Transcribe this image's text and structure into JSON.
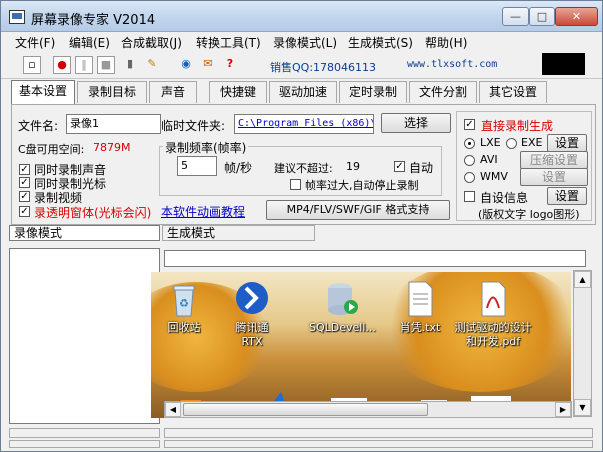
{
  "window": {
    "title": "屏幕录像专家 V2014",
    "min": "—",
    "max": "□",
    "close": "✕"
  },
  "menu": [
    "文件(F)",
    "编辑(E)",
    "合成截取(J)",
    "转换工具(T)",
    "录像模式(L)",
    "生成模式(S)",
    "帮助(H)"
  ],
  "toolbar": {
    "sales": "销售QQ:178046113",
    "site": "www.tlxsoft.com",
    "icons": [
      "new-file-icon",
      "record-icon",
      "pause-icon",
      "stop-icon",
      "camera-icon",
      "brush-icon",
      "globe-icon",
      "gift-icon",
      "help-icon"
    ]
  },
  "tabs": [
    "基本设置",
    "录制目标",
    "声音",
    "快捷键",
    "驱动加速",
    "定时录制",
    "文件分割",
    "其它设置"
  ],
  "basic": {
    "filename_label": "文件名:",
    "filename_value": "录像1",
    "temp_label": "临时文件夹:",
    "temp_value": "C:\\Program Files (x86)\\",
    "choose_btn": "选择",
    "disk_label": "C盘可用空间:",
    "disk_value": "7879M",
    "checks": [
      "同时录制声音",
      "同时录制光标",
      "录制视频",
      "录透明窗体(光标会闪)"
    ],
    "fps_group": "录制频率(帧率)",
    "fps_value": "5",
    "fps_unit": "帧/秒",
    "max_label": "建议不超过:",
    "max_value": "19",
    "auto_label": "自动",
    "stop_label": "帧率过大,自动停止录制",
    "tutorial_link": "本软件动画教程",
    "format_btn": "MP4/FLV/SWF/GIF 格式支持"
  },
  "right": {
    "direct_label": "直接录制生成",
    "lxe": "LXE",
    "exe": "EXE",
    "avi": "AVI",
    "wmv": "WMV",
    "set_btn": "设置",
    "compress_btn": "压缩设置",
    "set_btn2": "设置",
    "custom_label": "自设信息",
    "set_btn3": "设置",
    "logo_label": "(版权文字 logo图形)"
  },
  "lower": {
    "record_mode_tab": "录像模式",
    "gen_mode_tab": "生成模式",
    "desktop_icons": [
      "回收站",
      "腾讯通RTX",
      "SQLDevell...",
      "肖凭.txt",
      "测试驱动的设计和开发.pdf"
    ]
  },
  "colors": {
    "red": "#d60000",
    "link": "#0000cc",
    "accent": "#0a3d91"
  }
}
